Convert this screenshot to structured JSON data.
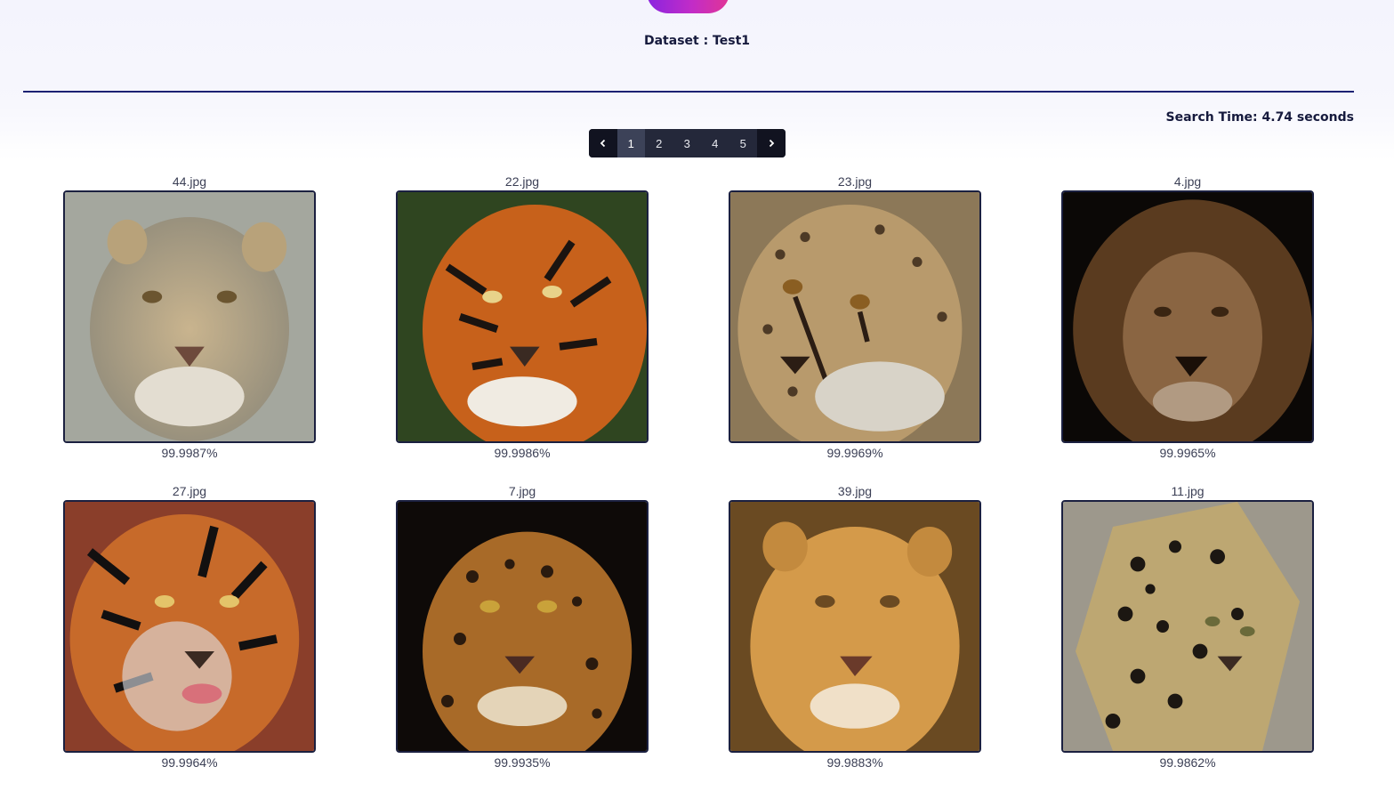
{
  "header": {
    "dataset_label": "Dataset : Test1",
    "search_time": "Search Time: 4.74 seconds"
  },
  "pagination": {
    "pages": [
      "1",
      "2",
      "3",
      "4",
      "5"
    ],
    "active_page": "1"
  },
  "results": [
    {
      "name": "44.jpg",
      "score": "99.9987%",
      "subject": "lioness"
    },
    {
      "name": "22.jpg",
      "score": "99.9986%",
      "subject": "tiger"
    },
    {
      "name": "23.jpg",
      "score": "99.9969%",
      "subject": "cheetah"
    },
    {
      "name": "4.jpg",
      "score": "99.9965%",
      "subject": "lion"
    },
    {
      "name": "27.jpg",
      "score": "99.9964%",
      "subject": "tiger"
    },
    {
      "name": "7.jpg",
      "score": "99.9935%",
      "subject": "leopard"
    },
    {
      "name": "39.jpg",
      "score": "99.9883%",
      "subject": "lioness"
    },
    {
      "name": "11.jpg",
      "score": "99.9862%",
      "subject": "jaguar"
    }
  ],
  "colors": {
    "accent_start": "#8a24e0",
    "accent_end": "#e13595",
    "divider": "#1c2173",
    "pager_bg": "#24283a"
  }
}
